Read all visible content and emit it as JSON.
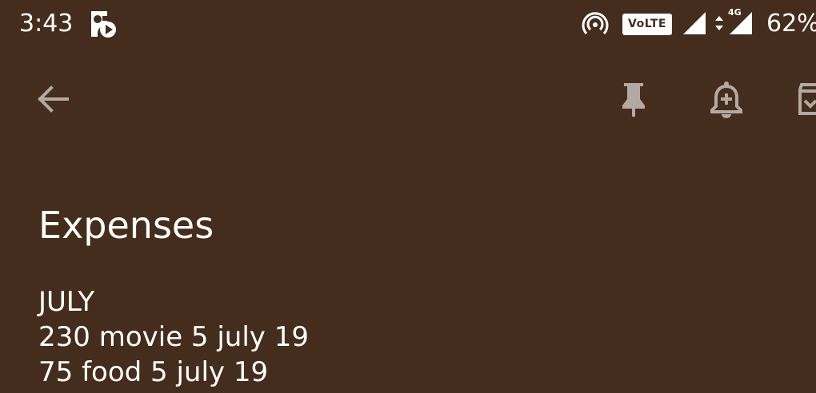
{
  "status_bar": {
    "time": "3:43",
    "volte_label": "VoLTE",
    "network_type": "4G",
    "battery": "62%",
    "icons": [
      "notification-app-icon",
      "hotspot-icon",
      "volte-icon",
      "signal-icon",
      "data-arrows-icon",
      "signal-icon-2"
    ]
  },
  "toolbar": {
    "icons": [
      "back-arrow-icon",
      "pin-icon",
      "reminder-bell-icon",
      "archive-icon"
    ]
  },
  "note": {
    "title": "Expenses",
    "lines": [
      "JULY",
      "230 movie 5 july 19",
      "75 food 5 july 19"
    ]
  },
  "colors": {
    "background": "#452d1d",
    "text": "#ffffff",
    "toolbar_icon": "#b3a9a2"
  }
}
